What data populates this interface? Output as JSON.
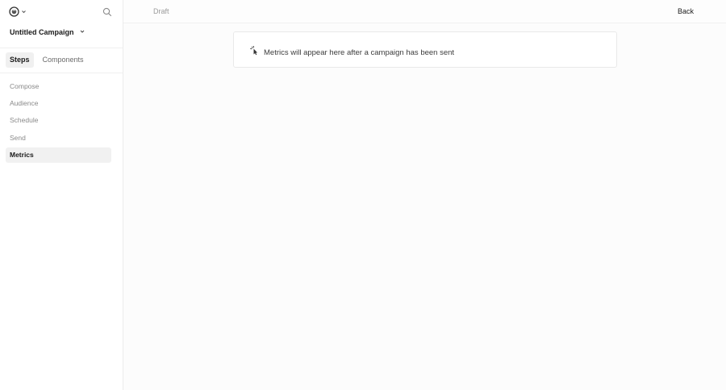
{
  "sidebar": {
    "logo_icon": "logo-icon",
    "campaign_name": "Untitled Campaign",
    "tabs": [
      {
        "label": "Steps",
        "active": true
      },
      {
        "label": "Components",
        "active": false
      }
    ],
    "steps": [
      {
        "label": "Compose",
        "active": false
      },
      {
        "label": "Audience",
        "active": false
      },
      {
        "label": "Schedule",
        "active": false
      },
      {
        "label": "Send",
        "active": false
      },
      {
        "label": "Metrics",
        "active": true
      }
    ]
  },
  "header": {
    "status": "Draft",
    "back_label": "Back"
  },
  "main": {
    "empty_message": "Metrics will appear here after a campaign has been sent",
    "empty_icon": "pointer-sparkle-icon"
  },
  "colors": {
    "background": "#fcfcfc",
    "active_bg": "#f1f1f1",
    "muted_text": "#8a8a8a"
  }
}
